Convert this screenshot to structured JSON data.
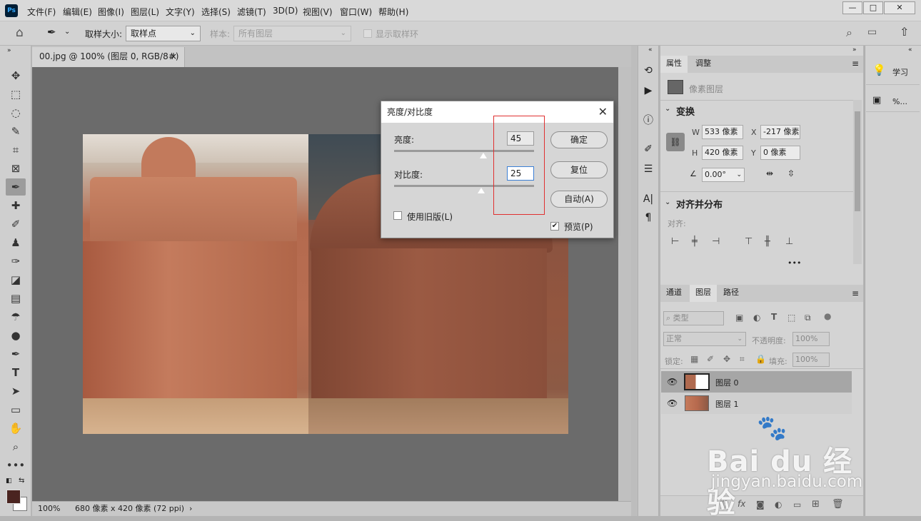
{
  "app": {
    "logo": "Ps"
  },
  "menu": [
    "文件(F)",
    "编辑(E)",
    "图像(I)",
    "图层(L)",
    "文字(Y)",
    "选择(S)",
    "滤镜(T)",
    "3D(D)",
    "视图(V)",
    "窗口(W)",
    "帮助(H)"
  ],
  "window_controls": {
    "minimize": "—",
    "restore": "□",
    "close": "✕"
  },
  "options_bar": {
    "sample_size_label": "取样大小:",
    "sample_size_value": "取样点",
    "sample_label": "样本:",
    "sample_value": "所有图层",
    "show_ring_label": "显示取样环"
  },
  "document": {
    "tab_title": "00.jpg @ 100% (图层 0, RGB/8#) *",
    "close": "×"
  },
  "status": {
    "zoom": "100%",
    "doc_info": "680 像素 x 420 像素 (72 ppi)",
    "arrow": "›"
  },
  "dialog": {
    "title": "亮度/对比度",
    "close": "✕",
    "brightness_label": "亮度:",
    "brightness_value": "45",
    "brightness_level": 0.64,
    "contrast_label": "对比度:",
    "contrast_value": "25",
    "contrast_level": 0.62,
    "legacy_label": "使用旧版(L)",
    "legacy_checked": false,
    "preview_label": "预览(P)",
    "preview_checked": true,
    "ok_label": "确定",
    "reset_label": "复位",
    "auto_label": "自动(A)"
  },
  "properties_panel": {
    "tabs": [
      "属性",
      "调整"
    ],
    "kind": "像素图层",
    "transform_title": "变换",
    "w_label": "W",
    "w_value": "533 像素",
    "x_label": "X",
    "x_value": "-217 像素",
    "h_label": "H",
    "h_value": "420 像素",
    "y_label": "Y",
    "y_value": "0 像素",
    "angle_value": "0.00°",
    "align_title": "对齐并分布",
    "align_label": "对齐:",
    "more": "•••"
  },
  "learn_panel": {
    "learn_label": "学习",
    "percent_label": "%..."
  },
  "layers_panel": {
    "tabs": [
      "通道",
      "图层",
      "路径"
    ],
    "filter_label": "类型",
    "blend_mode": "正常",
    "opacity_label": "不透明度:",
    "opacity_value": "100%",
    "lock_label": "锁定:",
    "fill_label": "填充:",
    "fill_value": "100%",
    "layers": [
      {
        "name": "图层 0",
        "selected": true
      },
      {
        "name": "图层 1",
        "selected": false
      }
    ]
  },
  "watermark": {
    "brand": "Bai du 经验",
    "url": "jingyan.baidu.com"
  }
}
